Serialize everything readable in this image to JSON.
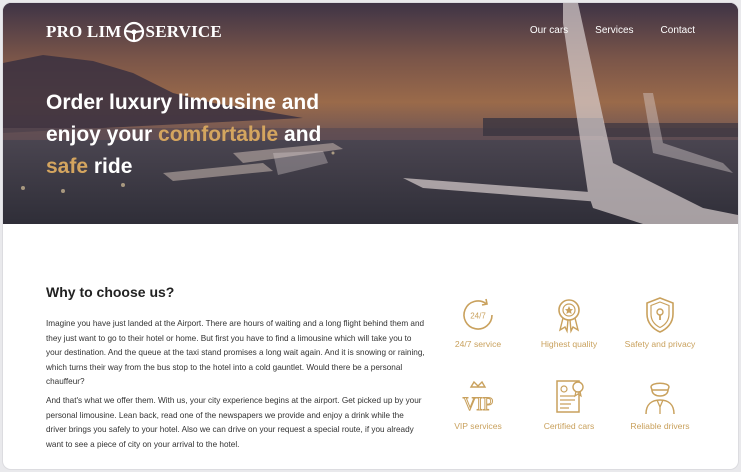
{
  "brand": {
    "part1": "PRO LIM",
    "part2": "SERVICE"
  },
  "nav": {
    "cars": "Our cars",
    "services": "Services",
    "contact": "Contact"
  },
  "hero": {
    "line1": "Order luxury limousine and",
    "line2_pre": "enjoy your ",
    "line2_gold": "comfortable",
    "line2_post": " and",
    "line3_gold": "safe",
    "line3_post": " ride"
  },
  "why": {
    "title": "Why to choose us?",
    "paragraph1": "Imagine you have just landed at the Airport. There are hours of waiting and a long flight behind them and they just want to go to their hotel or home. But first you have to find a limousine which will take you to your destination. And the queue at the taxi stand promises a long wait again. And it is snowing or raining, which turns their way from the bus stop to the hotel into a cold gauntlet. Would there be a personal chauffeur?",
    "paragraph2": "And that's what we offer them. With us, your city experience begins at the airport. Get picked up by your personal limousine. Lean back, read one of the newspapers we provide and enjoy a drink while the driver brings you safely to your hotel. Also we can drive on your request a special route, if you already want to see a piece of city on your arrival to the hotel."
  },
  "features": {
    "f1": {
      "label": "24/7 service",
      "icon": "clock-24-7-icon",
      "badge": "24/7"
    },
    "f2": {
      "label": "Highest quality",
      "icon": "award-medal-icon"
    },
    "f3": {
      "label": "Safety and privacy",
      "icon": "shield-lock-icon"
    },
    "f4": {
      "label": "VIP services",
      "icon": "vip-crown-icon",
      "badge": "VIP"
    },
    "f5": {
      "label": "Certified cars",
      "icon": "certificate-icon"
    },
    "f6": {
      "label": "Reliable drivers",
      "icon": "driver-icon"
    }
  },
  "colors": {
    "accent": "#c9a15d",
    "heroGold": "#d4a55f",
    "text": "#333333"
  }
}
